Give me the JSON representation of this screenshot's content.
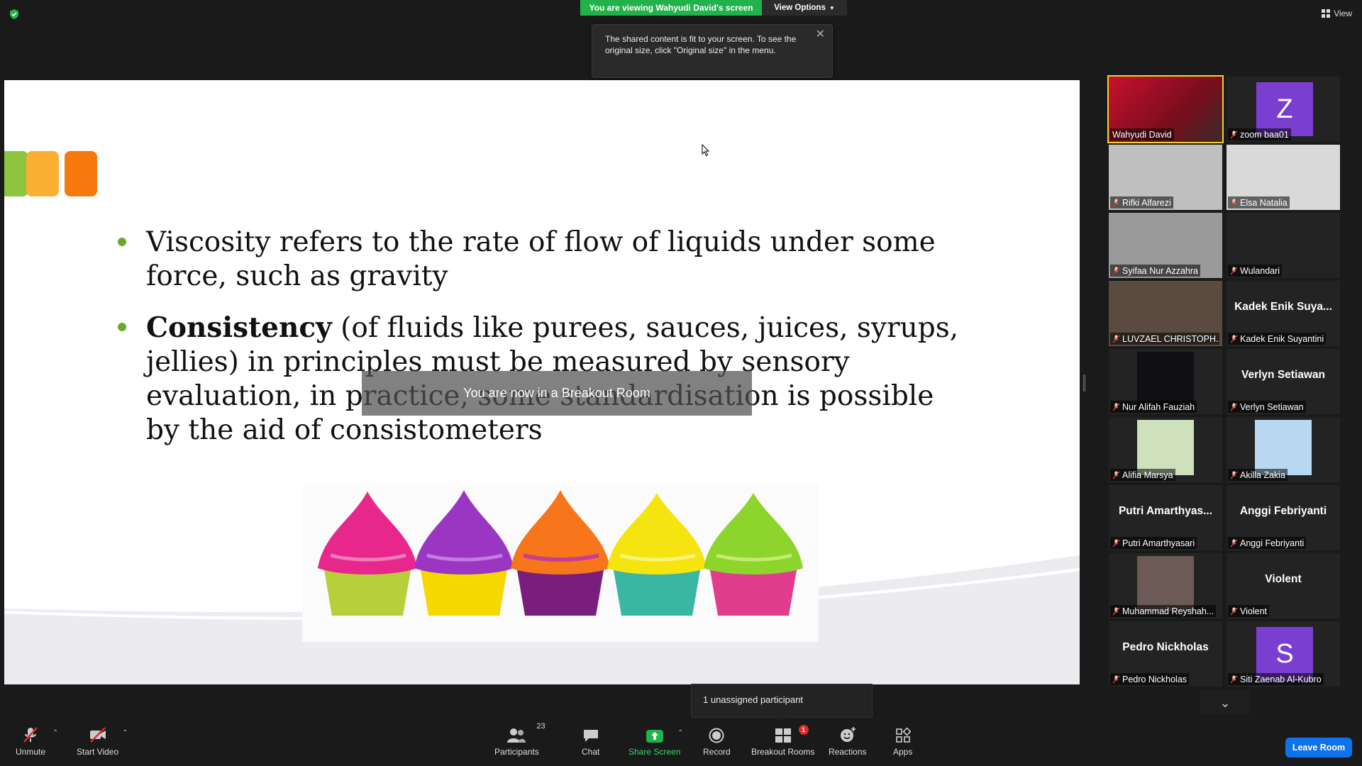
{
  "top": {
    "viewing_banner": "You are viewing Wahyudi David's screen",
    "view_options": "View Options",
    "view_label": "View",
    "tooltip": "The shared content is fit to your screen. To see the original size, click \"Original size\" in the menu."
  },
  "slide": {
    "bullet1": "Viscosity refers to the rate of flow of liquids under some force, such as gravity",
    "bullet2_bold": "Consistency",
    "bullet2_rest": " (of fluids like purees, sauces, juices, syrups, jellies) in principles must be measured by sensory evaluation, in practice, some standardisation is possible by the aid of consistometers"
  },
  "breakout_toast": "You are now in a Breakout Room",
  "gallery": [
    {
      "name": "Wahyudi David",
      "kind": "video",
      "active": true
    },
    {
      "name": "zoom baa01",
      "kind": "avatar",
      "avatar_letter": "Z",
      "avatar_color": "#7a3fd0"
    },
    {
      "name": "Rifki Alfarezi",
      "kind": "video"
    },
    {
      "name": "Elsa Natalia",
      "kind": "video"
    },
    {
      "name": "Syifaa Nur Azzahra",
      "kind": "video"
    },
    {
      "name": "Wulandari",
      "kind": "blank"
    },
    {
      "name": "LUVZAEL CHRISTOPH...",
      "kind": "video"
    },
    {
      "name": "Kadek Enik Suyantini",
      "kind": "text",
      "big": "Kadek  Enik  Suya..."
    },
    {
      "name": "Nur Alifah Fauziah",
      "kind": "photo"
    },
    {
      "name": "Verlyn Setiawan",
      "kind": "text",
      "big": "Verlyn Setiawan"
    },
    {
      "name": "Alifia Marsya",
      "kind": "photo"
    },
    {
      "name": "Akilla Zakia",
      "kind": "photo"
    },
    {
      "name": "Putri Amarthyasari",
      "kind": "text",
      "big": "Putri  Amarthyas..."
    },
    {
      "name": "Anggi Febriyanti",
      "kind": "text",
      "big": "Anggi Febriyanti"
    },
    {
      "name": "Muhammad Reyshah...",
      "kind": "photo"
    },
    {
      "name": "Violent",
      "kind": "text",
      "big": "Violent"
    },
    {
      "name": "Pedro Nickholas",
      "kind": "text",
      "big": "Pedro Nickholas"
    },
    {
      "name": "Siti Zaenab Al-Kubro",
      "kind": "avatar",
      "avatar_letter": "S",
      "avatar_color": "#7a3fd0"
    }
  ],
  "unassigned": "1 unassigned participant",
  "toolbar": {
    "unmute": "Unmute",
    "start_video": "Start Video",
    "participants": "Participants",
    "participants_count": "23",
    "chat": "Chat",
    "share_screen": "Share Screen",
    "record": "Record",
    "breakout_rooms": "Breakout Rooms",
    "breakout_badge": "1",
    "reactions": "Reactions",
    "apps": "Apps",
    "leave": "Leave Room"
  },
  "colors": {
    "banner_green": "#22b24c",
    "active_speaker": "#f3d32b",
    "leave_blue": "#0e72ed",
    "mute_red": "#e02828"
  }
}
